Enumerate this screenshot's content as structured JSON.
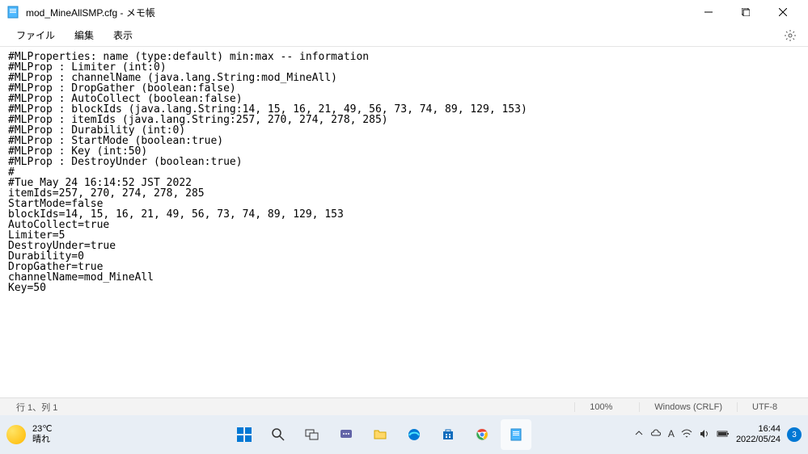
{
  "window": {
    "title": "mod_MineAllSMP.cfg - メモ帳"
  },
  "menu": {
    "file": "ファイル",
    "edit": "編集",
    "view": "表示"
  },
  "content": {
    "lines": [
      "#MLProperties: name (type:default) min:max -- information",
      "#MLProp : Limiter (int:0)",
      "#MLProp : channelName (java.lang.String:mod_MineAll)",
      "#MLProp : DropGather (boolean:false)",
      "#MLProp : AutoCollect (boolean:false)",
      "#MLProp : blockIds (java.lang.String:14, 15, 16, 21, 49, 56, 73, 74, 89, 129, 153)",
      "#MLProp : itemIds (java.lang.String:257, 270, 274, 278, 285)",
      "#MLProp : Durability (int:0)",
      "#MLProp : StartMode (boolean:true)",
      "#MLProp : Key (int:50)",
      "#MLProp : DestroyUnder (boolean:true)",
      "#",
      "#Tue May 24 16:14:52 JST 2022",
      "itemIds=257, 270, 274, 278, 285",
      "StartMode=false",
      "blockIds=14, 15, 16, 21, 49, 56, 73, 74, 89, 129, 153",
      "AutoCollect=true",
      "Limiter=5",
      "DestroyUnder=true",
      "Durability=0",
      "DropGather=true",
      "channelName=mod_MineAll",
      "Key=50"
    ]
  },
  "status": {
    "position": "行 1、列 1",
    "zoom": "100%",
    "line_ending": "Windows (CRLF)",
    "encoding": "UTF-8"
  },
  "taskbar": {
    "weather_temp": "23℃",
    "weather_cond": "晴れ",
    "time": "16:44",
    "date": "2022/05/24",
    "notif_count": "3"
  }
}
